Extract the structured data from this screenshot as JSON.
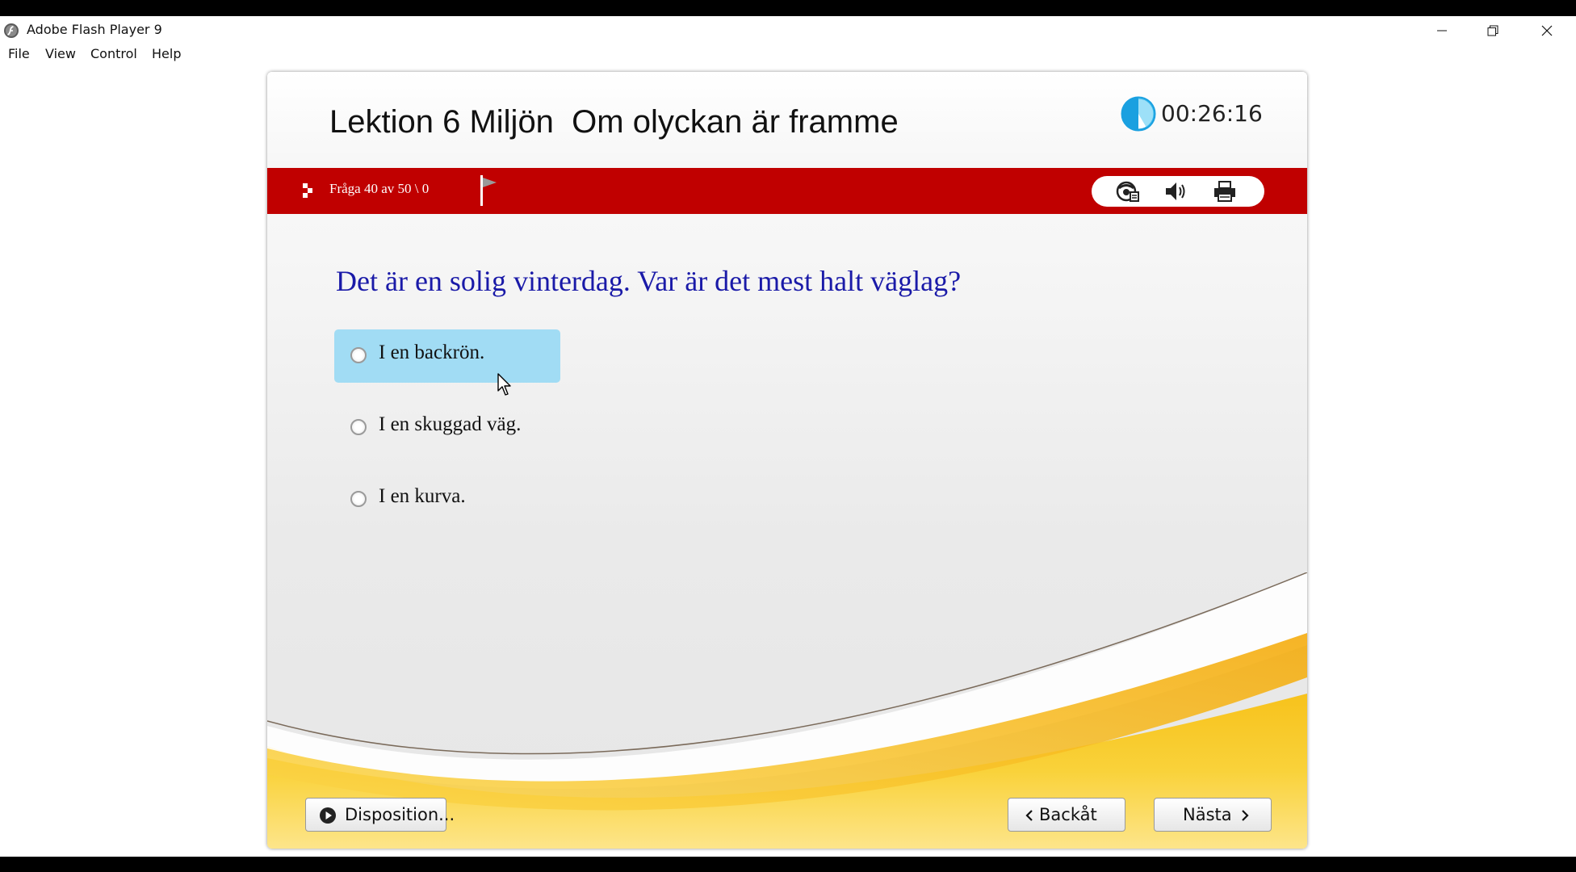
{
  "window": {
    "title": "Adobe Flash Player 9",
    "controls": {
      "minimize": "minimize-icon",
      "restore": "restore-icon",
      "close": "close-icon"
    }
  },
  "menu": [
    "File",
    "View",
    "Control",
    "Help"
  ],
  "lesson": {
    "title": "Lektion 6 Miljön  Om olyckan är framme",
    "timer": "00:26:16"
  },
  "toolbar": {
    "counter": "Fråga 40 av 50 \\ 0",
    "icons": [
      "help-icon",
      "speaker-icon",
      "printer-icon"
    ]
  },
  "question": {
    "text": "Det är en solig vinterdag. Var är det mest halt väglag?",
    "options": [
      {
        "label": "I en backrön.",
        "highlighted": true
      },
      {
        "label": "I en skuggad väg.",
        "highlighted": false
      },
      {
        "label": "I en kurva.",
        "highlighted": false
      }
    ]
  },
  "footer": {
    "disposition_label": "Disposition...",
    "back_label": "Backåt",
    "next_label": "Nästa"
  },
  "colors": {
    "header_bar": "#c00000",
    "question_text": "#1a1aa8",
    "option_highlight": "#a1dcf4",
    "swoosh": "#f4c01a"
  }
}
